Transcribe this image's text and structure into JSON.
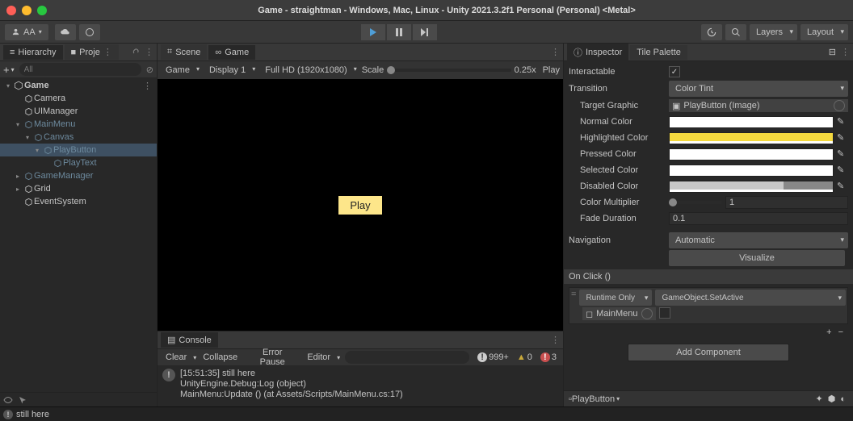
{
  "window_title": "Game - straightman - Windows, Mac, Linux - Unity 2021.3.2f1 Personal (Personal) <Metal>",
  "toolbar": {
    "account_label": "AA",
    "layers_label": "Layers",
    "layout_label": "Layout"
  },
  "hierarchy": {
    "tab_label": "Hierarchy",
    "project_tab": "Proje",
    "search_placeholder": "All",
    "items": [
      {
        "label": "Game",
        "depth": 0,
        "arrow": "▾",
        "sel": false,
        "gray": false,
        "bold": true,
        "ico": "u"
      },
      {
        "label": "Camera",
        "depth": 1,
        "arrow": "",
        "sel": false,
        "gray": false,
        "ico": "cube"
      },
      {
        "label": "UIManager",
        "depth": 1,
        "arrow": "",
        "sel": false,
        "gray": false,
        "ico": "cube"
      },
      {
        "label": "MainMenu",
        "depth": 1,
        "arrow": "▾",
        "sel": false,
        "gray": true,
        "ico": "cube"
      },
      {
        "label": "Canvas",
        "depth": 2,
        "arrow": "▾",
        "sel": false,
        "gray": true,
        "ico": "cube"
      },
      {
        "label": "PlayButton",
        "depth": 3,
        "arrow": "▾",
        "sel": true,
        "gray": true,
        "ico": "cube"
      },
      {
        "label": "PlayText",
        "depth": 4,
        "arrow": "",
        "sel": false,
        "gray": true,
        "ico": "cube"
      },
      {
        "label": "GameManager",
        "depth": 1,
        "arrow": "▸",
        "sel": false,
        "gray": true,
        "ico": "cube"
      },
      {
        "label": "Grid",
        "depth": 1,
        "arrow": "▸",
        "sel": false,
        "gray": false,
        "ico": "cube"
      },
      {
        "label": "EventSystem",
        "depth": 1,
        "arrow": "",
        "sel": false,
        "gray": false,
        "ico": "cube"
      }
    ]
  },
  "center": {
    "scene_tab": "Scene",
    "game_tab": "Game",
    "game_dropdown": "Game",
    "display": "Display 1",
    "resolution": "Full HD (1920x1080)",
    "scale_label": "Scale",
    "scale_value": "0.25x",
    "play_label": "Play"
  },
  "inspector": {
    "tab_label": "Inspector",
    "tile_palette": "Tile Palette",
    "interactable_label": "Interactable",
    "transition_label": "Transition",
    "transition_value": "Color Tint",
    "target_graphic_label": "Target Graphic",
    "target_graphic_value": "PlayButton (Image)",
    "normal_color_label": "Normal Color",
    "highlighted_color_label": "Highlighted Color",
    "pressed_color_label": "Pressed Color",
    "selected_color_label": "Selected Color",
    "disabled_color_label": "Disabled Color",
    "color_multiplier_label": "Color Multiplier",
    "color_multiplier_value": "1",
    "fade_duration_label": "Fade Duration",
    "fade_duration_value": "0.1",
    "navigation_label": "Navigation",
    "navigation_value": "Automatic",
    "visualize_label": "Visualize",
    "onclick_header": "On Click ()",
    "runtime_only": "Runtime Only",
    "function_name": "GameObject.SetActive",
    "object_ref": "MainMenu",
    "add_component_label": "Add Component",
    "asset_footer": "PlayButton",
    "colors": {
      "normal": "#ffffff",
      "highlighted": "#f4d93f",
      "pressed": "#ffffff",
      "selected": "#ffffff",
      "disabled": "#c8c8c8"
    }
  },
  "console": {
    "tab_label": "Console",
    "clear": "Clear",
    "collapse": "Collapse",
    "error_pause": "Error Pause",
    "editor": "Editor",
    "info_count": "999+",
    "warn_count": "0",
    "error_count": "3",
    "log_time": "[15:51:35] still here",
    "log_line2": "UnityEngine.Debug:Log (object)",
    "log_line3": "MainMenu:Update () (at Assets/Scripts/MainMenu.cs:17)",
    "status": "still here"
  }
}
